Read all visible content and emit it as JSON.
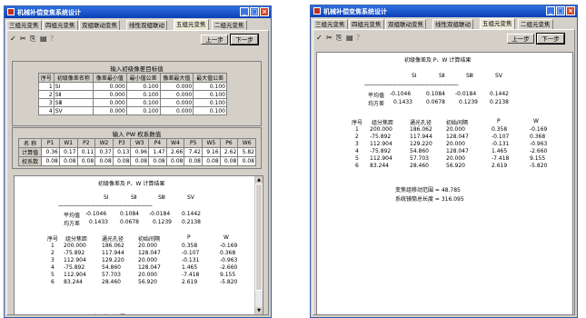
{
  "window": {
    "title": "机械补偿变焦系统设计",
    "min_btn": "_",
    "max_btn": "□",
    "close_btn": "×"
  },
  "tabs": [
    "三组元变焦",
    "四组元变焦",
    "双组联动变焦",
    "线性双组联动",
    "五组元变焦",
    "二组元变焦"
  ],
  "active_tab": 4,
  "toolbar": {
    "icons": [
      "check-icon",
      "cut-icon",
      "copy-icon",
      "paste-icon",
      "help-icon"
    ],
    "icon_glyphs": [
      "✓",
      "✂",
      "⎘",
      "▤",
      "?"
    ],
    "prev_label": "上一步",
    "next_label": "下一步"
  },
  "input_group": {
    "title": "输入初级像差目标值",
    "headers": [
      "序号",
      "初级像差名称",
      "像差最小值",
      "最小值公差",
      "像差最大值",
      "最大值公差"
    ],
    "rows": [
      [
        "1",
        "SⅠ",
        "0.000",
        "0.100",
        "0.000",
        "0.100"
      ],
      [
        "2",
        "SⅡ",
        "0.000",
        "0.100",
        "0.000",
        "0.100"
      ],
      [
        "3",
        "SⅢ",
        "0.000",
        "0.100",
        "0.000",
        "0.100"
      ],
      [
        "4",
        "SⅤ",
        "0.000",
        "0.100",
        "0.000",
        "0.100"
      ]
    ]
  },
  "pw_group": {
    "title": "输入 PW 权系数值",
    "headers": [
      "名 称",
      "P1",
      "W1",
      "P2",
      "W2",
      "P3",
      "W3",
      "P4",
      "W4",
      "P5",
      "W5",
      "P6",
      "W6"
    ],
    "rows": [
      [
        "计算值",
        "0.36",
        "0.17",
        "0.11",
        "0.37",
        "0.13",
        "0.96",
        "1.47",
        "2.66",
        "7.42",
        "9.16",
        "2.62",
        "5.82"
      ],
      [
        "权系数",
        "0.08",
        "0.08",
        "0.08",
        "0.08",
        "0.08",
        "0.08",
        "0.08",
        "0.08",
        "0.08",
        "0.08",
        "0.08",
        "0.08"
      ]
    ]
  },
  "results": {
    "title": "初级像差及 P、W 计算结果",
    "aberr_headers": [
      "SⅠ",
      "SⅡ",
      "SⅢ",
      "SⅤ"
    ],
    "mean_label": "平均值",
    "mean_values": [
      "-0.1046",
      "0.1084",
      "-0.0184",
      "0.1442"
    ],
    "std_label": "均方差",
    "std_values": [
      "0.1433",
      "0.0678",
      "0.1239",
      "0.2138"
    ],
    "table_headers": [
      "序号",
      "组分焦距",
      "通光孔径",
      "初始间隔",
      "P",
      "W"
    ],
    "rows": [
      [
        "1",
        "200.000",
        "186.062",
        "20.000",
        "0.358",
        "-0.169"
      ],
      [
        "2",
        "-75.892",
        "117.944",
        "128.047",
        "-0.107",
        "0.368"
      ],
      [
        "3",
        "112.904",
        "129.220",
        "20.000",
        "-0.131",
        "-0.963"
      ],
      [
        "4",
        "-75.892",
        "54.860",
        "128.047",
        "1.465",
        "-2.660"
      ],
      [
        "5",
        "112.904",
        "57.703",
        "20.000",
        "-7.418",
        "9.155"
      ],
      [
        "6",
        "83.244",
        "28.460",
        "56.920",
        "2.619",
        "-5.820"
      ]
    ],
    "move_range_label": "变焦组移动范围 = 48.785",
    "total_length_label": "系统镜筒总长度 = 316.095"
  }
}
